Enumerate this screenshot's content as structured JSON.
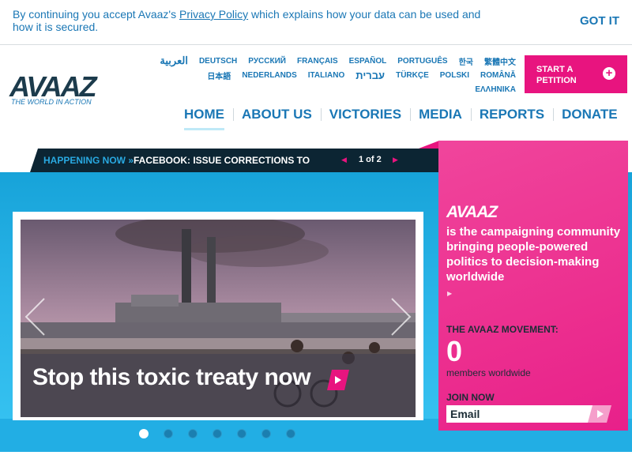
{
  "cookie": {
    "text_before": "By continuing you accept Avaaz's ",
    "link": "Privacy Policy",
    "text_after": " which explains how your data can be used and how it is secured.",
    "button": "GOT IT"
  },
  "logo": {
    "wordmark": "AVAAZ",
    "tagline": "THE WORLD IN ACTION"
  },
  "languages": {
    "row1": [
      "العربية",
      "DEUTSCH",
      "РУССКИЙ",
      "FRANÇAIS",
      "ESPAÑOL",
      "PORTUGUÊS",
      "한국",
      "繁體中文"
    ],
    "row2": [
      "日本語",
      "NEDERLANDS",
      "ITALIANO",
      "עברית",
      "TÜRKÇE",
      "POLSKI",
      "ROMÂNĂ"
    ],
    "row3": [
      "ΕΛΛΗΝΙΚΑ"
    ]
  },
  "petition": {
    "label_line1": "START A",
    "label_line2": "PETITION",
    "icon": "plus-icon"
  },
  "nav": [
    "HOME",
    "ABOUT US",
    "VICTORIES",
    "MEDIA",
    "REPORTS",
    "DONATE"
  ],
  "happening": {
    "label": "HAPPENING NOW »",
    "text": "FACEBOOK: ISSUE CORRECTIONS TO",
    "counter": "1 of 2"
  },
  "slide": {
    "caption": "Stop this toxic treaty now",
    "dots": 7,
    "active_dot": 1
  },
  "panel": {
    "logo": "AVAAZ",
    "description": "is the campaigning community bringing people-powered politics to decision-making worldwide",
    "more": "▶",
    "movement_label": "THE AVAAZ MOVEMENT:",
    "count": "0",
    "count_label": "members worldwide",
    "join_label": "JOIN NOW",
    "email_placeholder": "Email"
  },
  "colors": {
    "brand_blue": "#1a77b5",
    "brand_pink": "#e8147f",
    "hero_blue": "#22aee4",
    "dark": "#0c2533"
  }
}
